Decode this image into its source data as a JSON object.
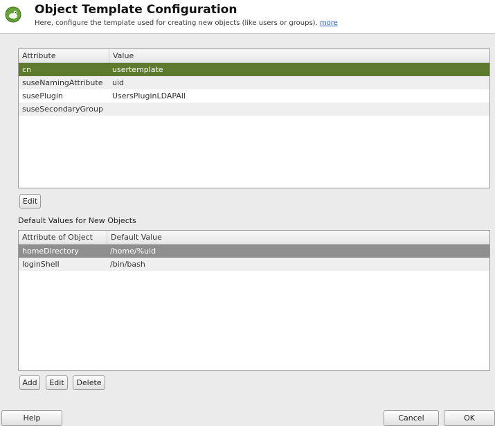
{
  "header": {
    "title": "Object Template Configuration",
    "subtitle": "Here, configure the template used for creating new objects (like users or groups).",
    "more_link": "more"
  },
  "attributes_table": {
    "columns": [
      "Attribute",
      "Value"
    ],
    "rows": [
      {
        "attribute": "cn",
        "value": "usertemplate",
        "selected": true
      },
      {
        "attribute": "suseNamingAttribute",
        "value": "uid"
      },
      {
        "attribute": "susePlugin",
        "value": "UsersPluginLDAPAll"
      },
      {
        "attribute": "suseSecondaryGroup",
        "value": ""
      }
    ]
  },
  "edit_button": "Edit",
  "defaults_label": "Default Values for New Objects",
  "defaults_table": {
    "columns": [
      "Attribute of Object",
      "Default Value"
    ],
    "rows": [
      {
        "attribute": "homeDirectory",
        "value": "/home/%uid",
        "selected": true
      },
      {
        "attribute": "loginShell",
        "value": "/bin/bash"
      }
    ]
  },
  "defaults_buttons": {
    "add": "Add",
    "edit": "Edit",
    "delete": "Delete"
  },
  "footer": {
    "help": "Help",
    "cancel": "Cancel",
    "ok": "OK"
  },
  "colors": {
    "selection_green": "#5d7a2f",
    "selection_gray": "#8f8f8f",
    "link": "#1d5fd0"
  }
}
